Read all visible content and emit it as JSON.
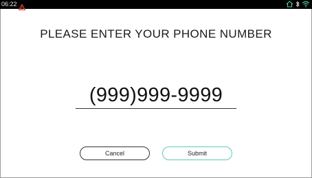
{
  "status_bar": {
    "time": "06:22",
    "icons": [
      "alert-icon",
      "cloud-home-icon",
      "bluetooth-icon",
      "wifi-icon"
    ],
    "alert_color": "#e0443a",
    "wifi_color": "#4fd1b4"
  },
  "main": {
    "prompt": "PLEASE ENTER YOUR PHONE NUMBER",
    "phone_value": "(999)999-9999"
  },
  "buttons": {
    "cancel_label": "Cancel",
    "submit_label": "Submit",
    "submit_accent": "#5fc9b4"
  }
}
